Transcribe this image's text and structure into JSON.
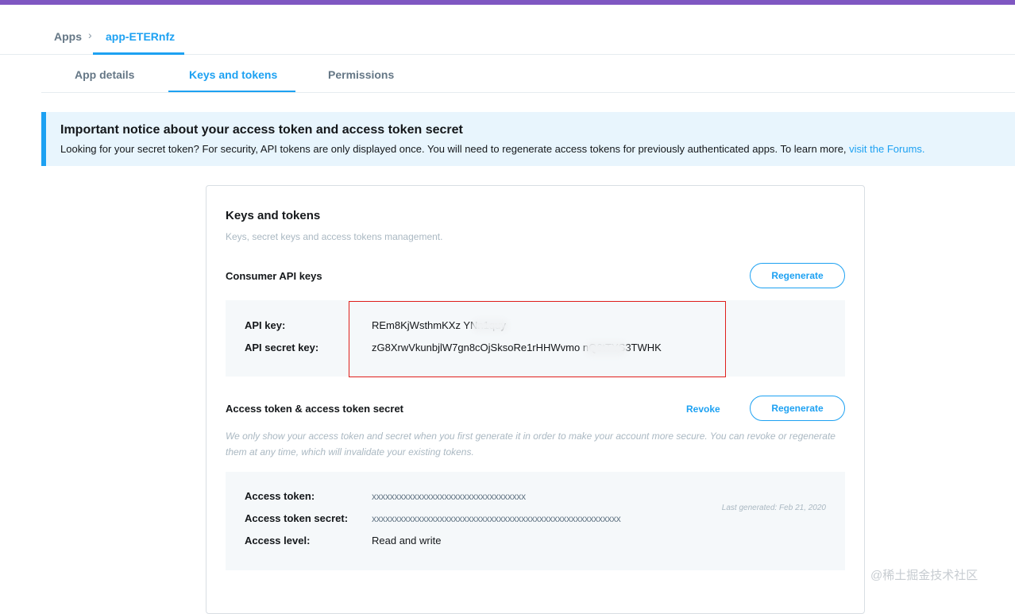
{
  "breadcrumb": {
    "apps": "Apps",
    "separator": "›",
    "current": "app-ETERnfz"
  },
  "tabs": [
    {
      "label": "App details"
    },
    {
      "label": "Keys and tokens"
    },
    {
      "label": "Permissions"
    }
  ],
  "notice": {
    "title": "Important notice about your access token and access token secret",
    "body": "Looking for your secret token? For security, API tokens are only displayed once. You will need to regenerate access tokens for previously authenticated apps. To learn more,",
    "link": "visit the Forums."
  },
  "card": {
    "title": "Keys and tokens",
    "subtitle": "Keys, secret keys and access tokens management."
  },
  "consumer": {
    "title": "Consumer API keys",
    "regenerate": "Regenerate",
    "api_key_label": "API key:",
    "api_key_value": "REm8KjWsthmKXz         YNn1quy",
    "api_secret_label": "API secret key:",
    "api_secret_value": "zG8XrwVkunbjlW7gn8cOjSksoRe1rHHWvmo         nQ6tTYS3TWHK"
  },
  "access": {
    "title": "Access token & access token secret",
    "revoke": "Revoke",
    "regenerate": "Regenerate",
    "description": "We only show your access token and secret when you first generate it in order to make your account more secure. You can revoke or regenerate them at any time, which will invalidate your existing tokens.",
    "token_label": "Access token:",
    "token_value": "xxxxxxxxxxxxxxxxxxxxxxxxxxxxxxxxxx",
    "secret_label": "Access token secret:",
    "secret_value": "xxxxxxxxxxxxxxxxxxxxxxxxxxxxxxxxxxxxxxxxxxxxxxxxxxxxxxx",
    "level_label": "Access level:",
    "level_value": "Read and write",
    "last_generated": "Last generated: Feb 21, 2020"
  },
  "watermark": "@稀土掘金技术社区",
  "colors": {
    "accent": "#1da1f2",
    "topbar": "#7f57c2",
    "highlight": "#e0201c"
  }
}
